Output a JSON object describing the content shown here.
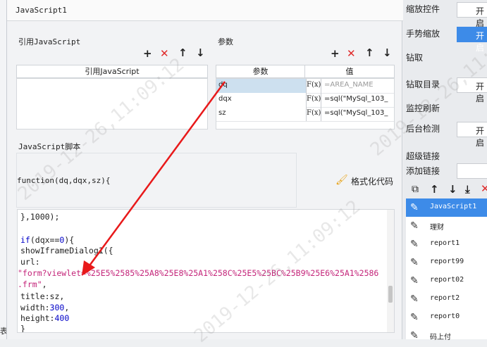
{
  "dialog": {
    "title": "JavaScript1",
    "ref_section": {
      "title": "引用JavaScript",
      "column_header": "引用JavaScript"
    },
    "params_section": {
      "title": "参数",
      "col_param": "参数",
      "col_value": "值",
      "rows": [
        {
          "name": "dq",
          "fx": "F(x)",
          "value": "=AREA_NAME"
        },
        {
          "name": "dqx",
          "fx": "F(x)",
          "value": "=sql(\"MySql_103_"
        },
        {
          "name": "sz",
          "fx": "F(x)",
          "value": "=sql(\"MySql_103_"
        }
      ]
    },
    "script_section": {
      "title": "JavaScript脚本",
      "signature": "function(dq,dqx,sz){",
      "format_label": "格式化代码",
      "format_icon": "brush-icon",
      "lines": [
        {
          "text": "},1000);"
        },
        {
          "kw": "if",
          "text": "(dqx==",
          "num": "0",
          "tail": "){"
        },
        {
          "text": "showIframeDialog1({"
        },
        {
          "text": "      url:"
        },
        {
          "str": "\"form?viewlet=%25E5%2585%25A8%25E8%25A1%258C%25E5%25BC%25B9%25E6%25A1%2586"
        },
        {
          "str": ".frm\"",
          "tail": ","
        },
        {
          "text": "      title:sz,"
        },
        {
          "text": "width:",
          "num": "300",
          "tail": ","
        },
        {
          "text": "height:",
          "num": "400"
        },
        {
          "text": "}"
        }
      ]
    },
    "toolbar_icons": [
      "add-icon",
      "delete-icon",
      "move-up-icon",
      "move-down-icon"
    ]
  },
  "right_panel": {
    "zoom_control_label": "缩放控件",
    "zoom_control_value": "开启",
    "gesture_zoom_label": "手势缩放",
    "gesture_zoom_value": "开启",
    "drill_label": "钻取",
    "drill_dir_label": "钻取目录",
    "drill_dir_value": "开启",
    "monitor_refresh_label": "监控刷新",
    "bg_detect_label": "后台检测",
    "bg_detect_value": "开启",
    "hyperlink_label": "超级链接",
    "add_link_label": "添加链接",
    "links": [
      {
        "name": "JavaScript1",
        "selected": true
      },
      {
        "name": "理财",
        "selected": false
      },
      {
        "name": "report1",
        "selected": false
      },
      {
        "name": "report99",
        "selected": false
      },
      {
        "name": "report02",
        "selected": false
      },
      {
        "name": "report2",
        "selected": false
      },
      {
        "name": "report0",
        "selected": false
      },
      {
        "name": "码上付",
        "selected": false
      }
    ]
  },
  "left_strip_text": "表",
  "watermark": "2019-12-26,11:09:12",
  "colors": {
    "accent": "#3d8be8",
    "delete": "#e02b2b",
    "keyword": "#0000c8",
    "string": "#c4257a",
    "arrow": "#e8191a"
  }
}
